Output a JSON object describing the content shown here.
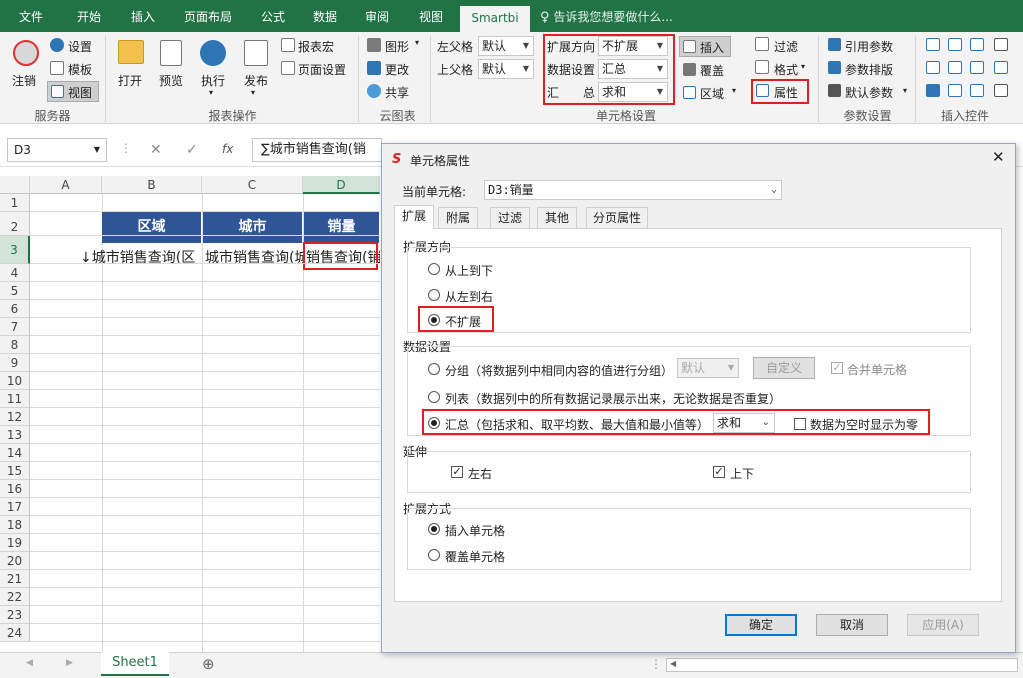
{
  "ribbon": {
    "tabs": [
      "文件",
      "开始",
      "插入",
      "页面布局",
      "公式",
      "数据",
      "审阅",
      "视图",
      "Smartbi"
    ],
    "active_tab": "Smartbi",
    "tell_me": "告诉我您想要做什么...",
    "server": {
      "logout": "注销",
      "settings": "设置",
      "template": "模板",
      "view": "视图",
      "group": "服务器"
    },
    "report_ops": {
      "open": "打开",
      "preview": "预览",
      "execute": "执行",
      "publish": "发布",
      "report_macro": "报表宏",
      "page_setup": "页面设置",
      "group": "报表操作"
    },
    "cloud_chart": {
      "chart": "图形",
      "update": "更改",
      "share": "共享",
      "group": "云图表"
    },
    "cell_settings": {
      "left_parent": "左父格",
      "left_parent_val": "默认",
      "top_parent": "上父格",
      "top_parent_val": "默认",
      "expand_dir": "扩展方向",
      "expand_dir_val": "不扩展",
      "data_setting": "数据设置",
      "data_setting_val": "汇总",
      "summary": "汇　　总",
      "summary_val": "求和",
      "insert": "插入",
      "cover": "覆盖",
      "region": "区域",
      "property": "属性",
      "group": "单元格设置"
    },
    "params": {
      "filter": "过滤",
      "format": "格式",
      "ref_param": "引用参数",
      "param_layout": "参数排版",
      "default_param": "默认参数",
      "group": "参数设置"
    },
    "insert_ctrl": {
      "group": "插入控件"
    }
  },
  "formula_bar": {
    "cell_ref": "D3",
    "cancel": "✕",
    "confirm": "✓",
    "fx": "fx",
    "content": "∑城市销售查询(销"
  },
  "sheet": {
    "columns": [
      "A",
      "B",
      "C",
      "D"
    ],
    "rows": [
      "1",
      "2",
      "3",
      "4",
      "5",
      "6",
      "7",
      "8",
      "9",
      "10",
      "11",
      "12",
      "13",
      "14",
      "15",
      "16",
      "17",
      "18",
      "19",
      "20",
      "21",
      "22",
      "23",
      "24"
    ],
    "header_cells": [
      "区域",
      "城市",
      "销量"
    ],
    "row3": [
      "↓城市销售查询(区",
      "城市销售查询(城",
      "销售查询(销"
    ],
    "tab": "Sheet1",
    "add_sheet": "⊕"
  },
  "dialog": {
    "title": "单元格属性",
    "current_cell_label": "当前单元格:",
    "current_cell_val": "D3:销量",
    "tabs": [
      "扩展",
      "附属",
      "过滤",
      "其他",
      "分页属性"
    ],
    "expand_dir_legend": "扩展方向",
    "dir_options": [
      "从上到下",
      "从左到右",
      "不扩展"
    ],
    "dir_selected": 2,
    "data_legend": "数据设置",
    "group_opt": "分组（将数据列中相同内容的值进行分组）",
    "group_sel": "默认",
    "custom_btn": "自定义",
    "merge_cells": "合并单元格",
    "list_opt": "列表（数据列中的所有数据记录展示出来，无论数据是否重复）",
    "summary_opt": "汇总（包括求和、取平均数、最大值和最小值等）",
    "summary_sel": "求和",
    "zero_when_empty": "数据为空时显示为零",
    "extend_legend": "延伸",
    "left_right": "左右",
    "up_down": "上下",
    "mode_legend": "扩展方式",
    "insert_cell": "插入单元格",
    "cover_cell": "覆盖单元格",
    "ok": "确定",
    "cancel": "取消",
    "apply": "应用(A)",
    "close": "✕"
  },
  "colors": {
    "excel_green": "#217346",
    "header_blue": "#2f5597",
    "highlight_red": "#e02020"
  }
}
